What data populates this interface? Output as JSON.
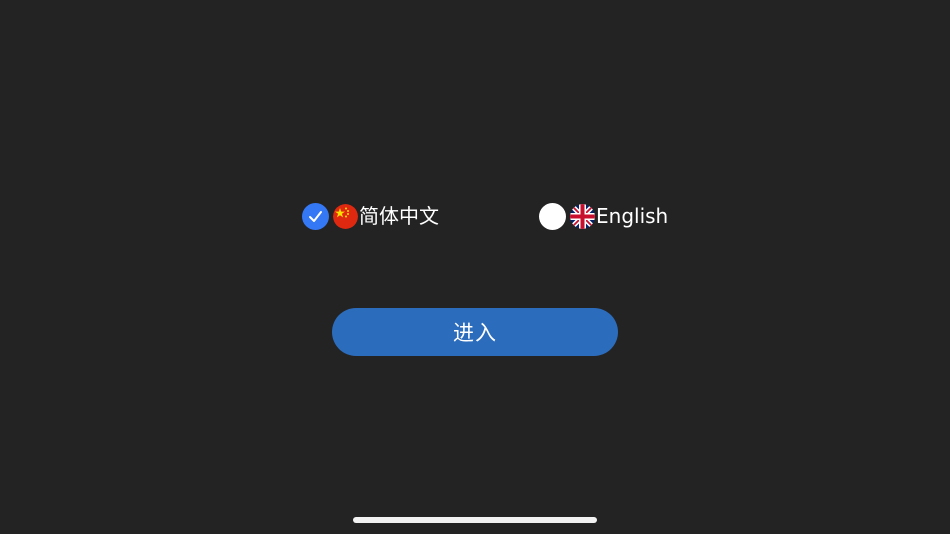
{
  "languages": {
    "zh": {
      "label": "简体中文",
      "selected": true,
      "flag_icon": "china-flag-icon"
    },
    "en": {
      "label": "English",
      "selected": false,
      "flag_icon": "uk-flag-icon"
    }
  },
  "enter_button": {
    "label": "进入"
  },
  "colors": {
    "background": "#232323",
    "selected_radio": "#3478f6",
    "button": "#2c6cbc",
    "text": "#ffffff"
  }
}
